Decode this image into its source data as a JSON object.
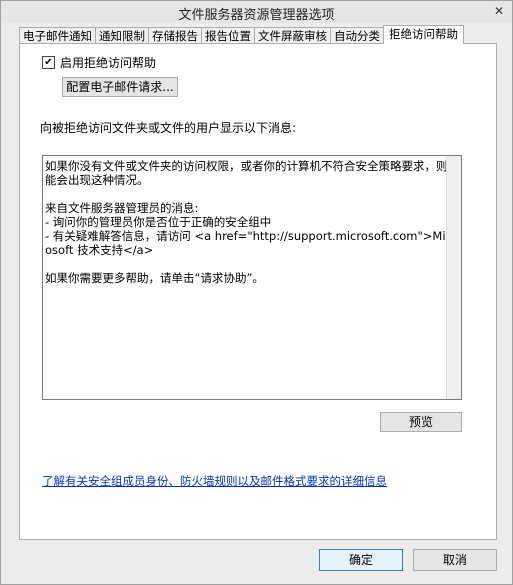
{
  "window": {
    "title": "文件服务器资源管理器选项",
    "close_glyph": "✕"
  },
  "tabs": [
    {
      "label": "电子邮件通知"
    },
    {
      "label": "通知限制"
    },
    {
      "label": "存储报告"
    },
    {
      "label": "报告位置"
    },
    {
      "label": "文件屏蔽审核"
    },
    {
      "label": "自动分类"
    },
    {
      "label": "拒绝访问帮助",
      "active": true
    }
  ],
  "panel": {
    "enable_checkbox": {
      "label": "启用拒绝访问帮助",
      "checked": true,
      "glyph": "✔"
    },
    "config_email_button": "配置电子邮件请求...",
    "message_label": "向被拒绝访问文件夹或文件的用户显示以下消息:",
    "message_text": "如果你没有文件或文件夹的访问权限，或者你的计算机不符合安全策略要求，则可能会出现这种情况。\n\n来自文件服务器管理员的消息:\n- 询问你的管理员你是否位于正确的安全组中\n- 有关疑难解答信息，请访问 <a href=\"http://support.microsoft.com\">Microsoft 技术支持</a>\n\n如果你需要更多帮助，请单击“请求协助”。",
    "preview_button": "预览",
    "help_link": "了解有关安全组成员身份、防火墙规则以及邮件格式要求的详细信息"
  },
  "footer": {
    "ok_button": "确定",
    "cancel_button": "取消"
  }
}
